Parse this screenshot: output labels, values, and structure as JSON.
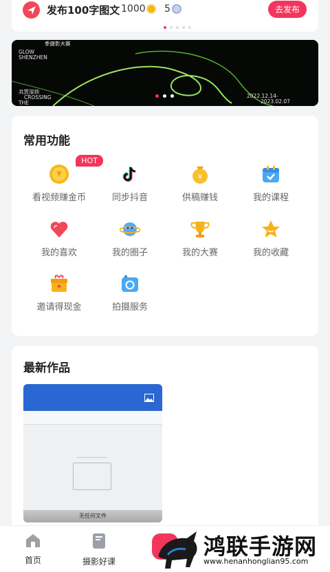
{
  "task": {
    "title": "发布100字图文",
    "coins": "1000",
    "gems": "5",
    "publish_label": "去发布"
  },
  "banner": {
    "lines_left": [
      "GLOW",
      "SHENZHEN"
    ],
    "lines_left2": [
      "CROSSING",
      "THE"
    ],
    "label_cn": "共赏深圳",
    "contest": "季摄影大赛",
    "date1": "2022.12.14-",
    "date2": "2023.02.07"
  },
  "functions": {
    "title": "常用功能",
    "hot_badge": "HOT",
    "items": [
      {
        "label": "看视频赚金币",
        "icon": "gold-coin-icon"
      },
      {
        "label": "同步抖音",
        "icon": "tiktok-icon"
      },
      {
        "label": "供稿赚钱",
        "icon": "money-bag-icon"
      },
      {
        "label": "我的课程",
        "icon": "calendar-check-icon"
      },
      {
        "label": "我的喜欢",
        "icon": "heart-icon"
      },
      {
        "label": "我的圈子",
        "icon": "planet-icon"
      },
      {
        "label": "我的大赛",
        "icon": "trophy-icon"
      },
      {
        "label": "我的收藏",
        "icon": "star-icon"
      },
      {
        "label": "邀请得现金",
        "icon": "gift-box-icon"
      },
      {
        "label": "拍摄服务",
        "icon": "camera-icon"
      }
    ]
  },
  "works": {
    "title": "最新作品",
    "thumb_caption": "无任何文件"
  },
  "tabs": [
    {
      "label": "首页",
      "icon": "home-icon"
    },
    {
      "label": "摄影好课",
      "icon": "book-icon"
    }
  ],
  "watermark": {
    "title": "鸿联手游网",
    "url": "www.henanhonglian95.com"
  },
  "colors": {
    "accent": "#f2365b",
    "background": "#f3f4f6"
  }
}
